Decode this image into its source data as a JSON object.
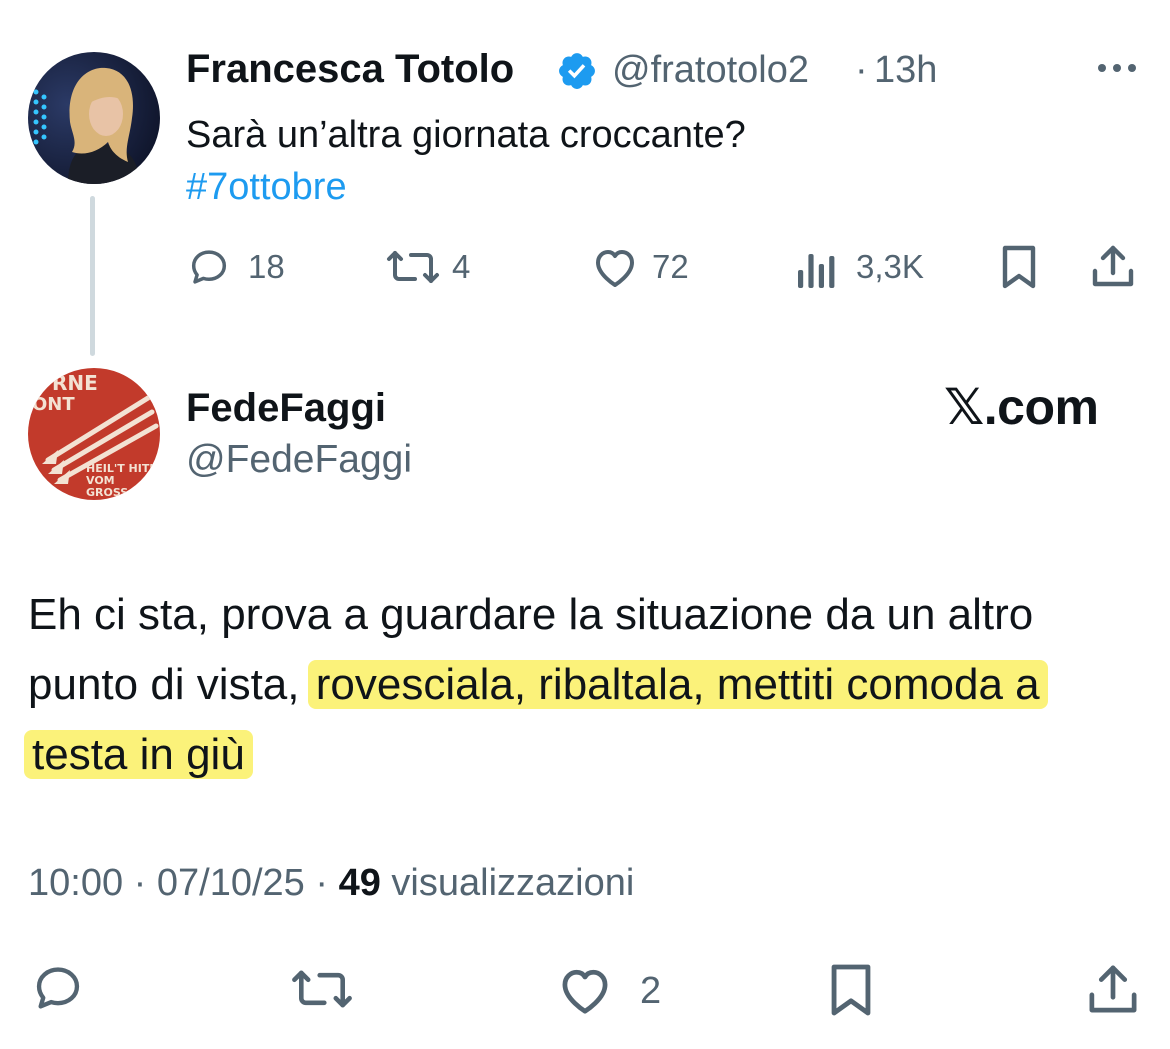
{
  "parent": {
    "author_name": "Francesca Totolo",
    "handle": "@fratotolo2",
    "separator": "·",
    "time": "13h",
    "text": "Sarà un’altra giornata croccante?",
    "hashtag": "#7ottobre",
    "stats": {
      "replies": "18",
      "reposts": "4",
      "likes": "72",
      "views": "3,3K"
    },
    "icons": [
      "verified-badge-icon",
      "more-icon",
      "reply-icon",
      "repost-icon",
      "like-icon",
      "views-icon",
      "bookmark-icon",
      "share-icon"
    ]
  },
  "reply": {
    "author_name": "FedeFaggi",
    "handle": "@FedeFaggi",
    "avatar_text": {
      "top": "RNE",
      "top2": "ONT",
      "bottom1": "HEIL'T HITL",
      "bottom2": "VOM",
      "bottom3": "GROSS"
    },
    "body_plain": "Eh ci sta, prova a guardare la situazione da un altro punto di vista, ",
    "body_highlight": "rovesciala, ribaltala, mettiti comoda a testa in giù",
    "time": "10:00",
    "date": "07/10/25",
    "views_count": "49",
    "views_label": "visualizzazioni",
    "likes": "2"
  },
  "brand": "𝕏.com",
  "colors": {
    "text": "#0f1419",
    "muted": "#536471",
    "link": "#1d9bf0",
    "highlight": "#fbf27a",
    "thread_line": "#cfd9de",
    "avatar2_bg": "#c23a2b"
  }
}
